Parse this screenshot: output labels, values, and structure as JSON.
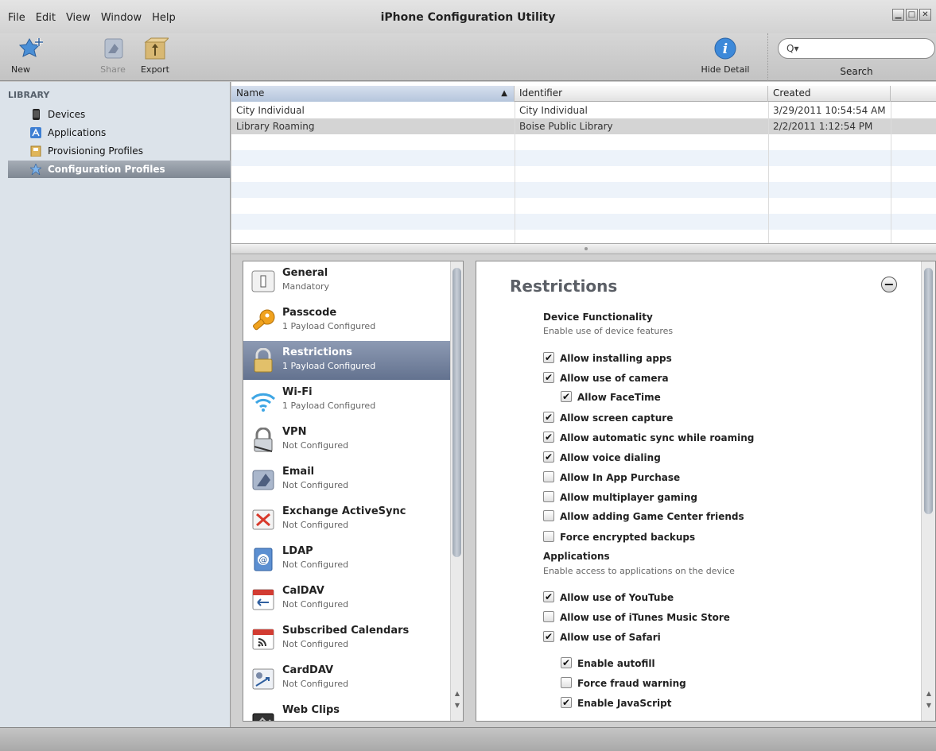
{
  "window": {
    "title": "iPhone Configuration Utility"
  },
  "menu": [
    "File",
    "Edit",
    "View",
    "Window",
    "Help"
  ],
  "toolbar": {
    "new_label": "New",
    "share_label": "Share",
    "export_label": "Export",
    "hide_detail_label": "Hide Detail",
    "search_label": "Search",
    "search_value": ""
  },
  "sidebar": {
    "header": "LIBRARY",
    "items": [
      {
        "label": "Devices",
        "icon": "device-icon"
      },
      {
        "label": "Applications",
        "icon": "applications-icon"
      },
      {
        "label": "Provisioning Profiles",
        "icon": "provisioning-profile-icon"
      },
      {
        "label": "Configuration Profiles",
        "icon": "configuration-profile-icon",
        "selected": true
      }
    ]
  },
  "table": {
    "columns": [
      "Name",
      "Identifier",
      "Created"
    ],
    "rows": [
      {
        "name": "City Individual",
        "identifier": "City Individual",
        "created": "3/29/2011 10:54:54 AM"
      },
      {
        "name": "Library Roaming",
        "identifier": "Boise Public Library",
        "created": "2/2/2011 1:12:54 PM",
        "selected": true
      }
    ]
  },
  "payloads": [
    {
      "name": "General",
      "status": "Mandatory",
      "icon": "general-icon"
    },
    {
      "name": "Passcode",
      "status": "1 Payload Configured",
      "icon": "key-icon"
    },
    {
      "name": "Restrictions",
      "status": "1 Payload Configured",
      "icon": "lock-icon",
      "selected": true
    },
    {
      "name": "Wi-Fi",
      "status": "1 Payload Configured",
      "icon": "wifi-icon"
    },
    {
      "name": "VPN",
      "status": "Not Configured",
      "icon": "vpn-icon"
    },
    {
      "name": "Email",
      "status": "Not Configured",
      "icon": "email-icon"
    },
    {
      "name": "Exchange ActiveSync",
      "status": "Not Configured",
      "icon": "exchange-icon"
    },
    {
      "name": "LDAP",
      "status": "Not Configured",
      "icon": "ldap-icon"
    },
    {
      "name": "CalDAV",
      "status": "Not Configured",
      "icon": "caldav-icon"
    },
    {
      "name": "Subscribed Calendars",
      "status": "Not Configured",
      "icon": "subscribed-calendar-icon"
    },
    {
      "name": "CardDAV",
      "status": "Not Configured",
      "icon": "carddav-icon"
    },
    {
      "name": "Web Clips",
      "status": "",
      "icon": "web-clips-icon"
    }
  ],
  "detail": {
    "title": "Restrictions",
    "device": {
      "title": "Device Functionality",
      "subtitle": "Enable use of device features",
      "options": [
        {
          "label": "Allow installing apps",
          "checked": true
        },
        {
          "label": "Allow use of camera",
          "checked": true
        },
        {
          "label": "Allow FaceTime",
          "checked": true
        },
        {
          "label": "Allow screen capture",
          "checked": true
        },
        {
          "label": "Allow automatic sync while roaming",
          "checked": true
        },
        {
          "label": "Allow voice dialing",
          "checked": true
        },
        {
          "label": "Allow In App Purchase",
          "checked": false
        },
        {
          "label": "Allow multiplayer gaming",
          "checked": false
        },
        {
          "label": "Allow adding Game Center friends",
          "checked": false
        },
        {
          "label": "Force encrypted backups",
          "checked": false
        }
      ]
    },
    "apps": {
      "title": "Applications",
      "subtitle": "Enable access to applications on the device",
      "options": [
        {
          "label": "Allow use of YouTube",
          "checked": true
        },
        {
          "label": "Allow use of iTunes Music Store",
          "checked": false
        },
        {
          "label": "Allow use of Safari",
          "checked": true
        },
        {
          "label": "Enable autofill",
          "checked": true
        },
        {
          "label": "Force fraud warning",
          "checked": false
        },
        {
          "label": "Enable JavaScript",
          "checked": true
        }
      ]
    }
  }
}
